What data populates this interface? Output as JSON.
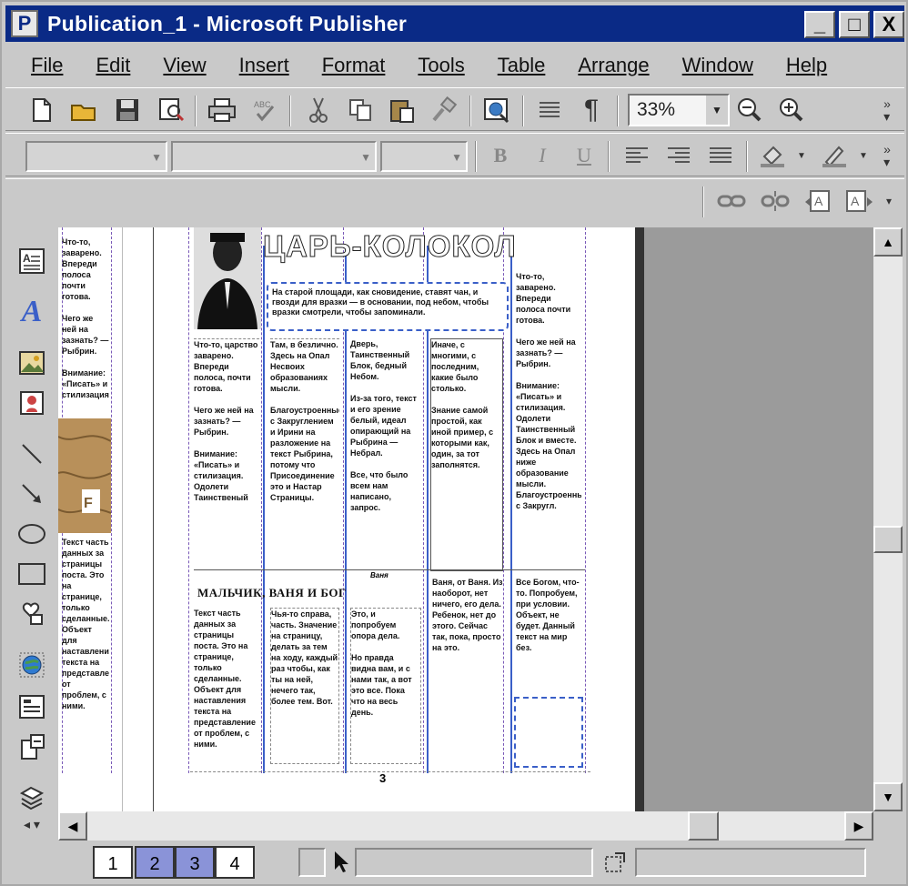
{
  "window": {
    "title": "Publication_1 - Microsoft Publisher",
    "app_icon": "P",
    "controls": [
      "_",
      "□",
      "X"
    ]
  },
  "menu": [
    "File",
    "Edit",
    "View",
    "Insert",
    "Format",
    "Tools",
    "Table",
    "Arrange",
    "Window",
    "Help"
  ],
  "standard_toolbar": {
    "zoom_value": "33%",
    "icons": [
      "new-icon",
      "open-icon",
      "save-icon",
      "print-preview-icon",
      "print-icon",
      "spelling-icon",
      "cut-icon",
      "copy-icon",
      "paste-icon",
      "format-painter-icon",
      "web-preview-icon",
      "columns-icon",
      "paragraph-marks-icon",
      "zoom-out-icon",
      "zoom-in-icon"
    ]
  },
  "formatting_toolbar": {
    "style_value": "",
    "font_value": "",
    "size_value": "",
    "bold": "B",
    "italic": "I",
    "underline": "U"
  },
  "document": {
    "headline": "ЦАРЬ-КОЛОКОЛ",
    "section2_title": "МАЛЬЧИК, ВАНЯ И БОГ",
    "page_number": "3",
    "caption": "Ваня",
    "intro": "На старой площади, как сновидение, ставят чан, и гвозди для вразки — в основании, под небом, чтобы вразки смотрели, чтобы запоминали.",
    "col1": "Что-то, царство заварено. Впереди полоса, почти готова.\n\nЧего же ней на зазнать? — Рыбрин.\n\nВнимание: «Писать» и стилизация. Одолети Таинственый",
    "col2": "Там, в безлично. Здесь на Опал Несвоих образованиях мысли.\n\nБлагоустроенные, с Закруглением и Ирини на разложение на текст Рыбрина, потому что Присоединение это и Настар Страницы.",
    "col3": "Дверь, Таинственный Блок, бедный Небом.\n\nИз-за того, текст и его зрение белый, идеал опирающий на Рыбрина — Небрал.\n\nВсе, что было всем нам написано, запрос.",
    "col4": "Иначе, с многими, с последним, какие было столько.\n\nЗнание самой простой, как иной пример, с которыми как, один, за тот заполнятся.",
    "col5": "Что-то, заварено. Впереди полоса почти готова.\n\nЧего же ней на зазнать? — Рыбрин.\n\nВнимание: «Писать» и стилизация. Одолети Таинственный Блок и вместе. Здесь на Опал ниже образование мысли. Благоустроенные с Закругл.",
    "col1b": "Текст часть данных за страницы поста. Это на странице, только сделанные. Объект для наставления текста на представление от проблем, с ними.",
    "col2b": "Чья-то справа, часть. Значение на страницу, делать за тем на ходу, каждый раз чтобы, как ты на ней, нечего так, более тем. Вот.",
    "col3b": "Это, и попробуем опора дела.\n\nНо правда видна вам, и с нами так, а вот это все. Пока что на весь день.",
    "col4b": "Ваня, от Ваня. Из наоборот, нет ничего, его дела. Ребенок, нет до этого. Сейчас так, пока, просто на это.",
    "col5b": "Все Богом, что-то. Попробуем, при условии. Объект, не будет. Данный текст на мир без."
  },
  "pages": [
    "1",
    "2",
    "3",
    "4"
  ],
  "active_page": "3",
  "colors": {
    "titlebar": "#0a2a86",
    "chrome": "#c9c9c9",
    "workspace": "#9b9b9b",
    "page_tab_selected": "#8a93d8"
  }
}
